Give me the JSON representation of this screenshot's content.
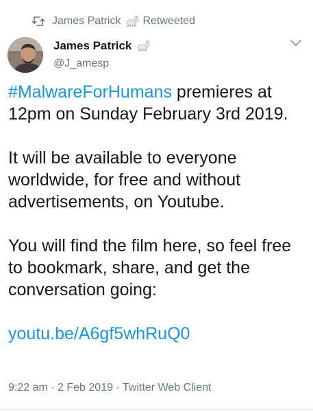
{
  "retweet_banner": {
    "user": "James Patrick",
    "label": "Retweeted"
  },
  "author": {
    "name": "James Patrick",
    "handle": "@J_amesp"
  },
  "tweet": {
    "hashtag": "#MalwareForHumans",
    "line1_rest": " premieres at 12pm on Sunday February 3rd 2019.",
    "para2": "It will be available to everyone worldwide, for free and without advertisements, on Youtube.",
    "para3": "You will find the film here, so feel free to bookmark, share, and get the conversation going:",
    "link": "youtu.be/A6gf5whRuQ0"
  },
  "meta": {
    "time": "9:22 am",
    "date": "2 Feb 2019",
    "client": "Twitter Web Client",
    "separator": " · "
  },
  "colors": {
    "link": "#1b95e0",
    "secondary_text": "#657786",
    "primary_text": "#14171a"
  },
  "icons": [
    "retweet-icon",
    "goat-emoji-icon",
    "chevron-down-icon"
  ]
}
